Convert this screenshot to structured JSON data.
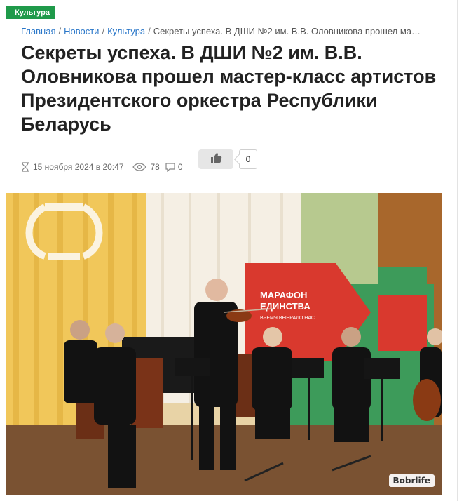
{
  "article": {
    "category": "Культура",
    "breadcrumb": {
      "home": "Главная",
      "news": "Новости",
      "culture": "Культура",
      "current": "Секреты успеха. В ДШИ №2 им. В.В. Оловникова прошел ма…"
    },
    "title": "Секреты успеха. В ДШИ №2 им. В.В. Оловникова прошел мастер-класс артистов Президентского оркестра Республики Беларусь",
    "meta": {
      "date": "15 ноября 2024 в 20:47",
      "views": "78",
      "comments": "0"
    },
    "likes": "0"
  },
  "photo": {
    "banner_line1": "МАРАФОН",
    "banner_line2": "ЕДИНСТВА",
    "banner_line3": "ВРЕМЯ ВЫБРАЛО НАС",
    "watermark": "Bobrlife"
  },
  "icons": [
    "hourglass-icon",
    "eye-icon",
    "comment-icon",
    "thumbs-up-icon"
  ],
  "colors": {
    "badge": "#1f9a4a",
    "link": "#2a77c9",
    "banner_red": "#d9392e"
  }
}
